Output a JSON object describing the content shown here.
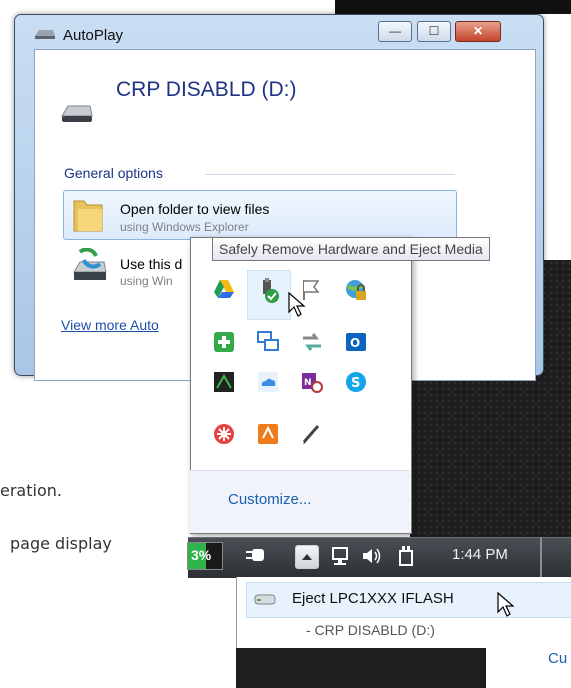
{
  "background": {
    "line1": "eration.",
    "line2": "page display"
  },
  "autoplay": {
    "title": "AutoPlay",
    "drive_label": "CRP DISABLD (D:)",
    "section_label": "General options",
    "option1_main": "Open folder to view files",
    "option1_sub": "using Windows Explorer",
    "option2_main": "Use this d",
    "option2_sub": "using Win",
    "link": "View more Auto"
  },
  "tray": {
    "tooltip": "Safely Remove Hardware and Eject Media",
    "customize_label": "Customize..."
  },
  "taskbar": {
    "battery_text": "3%",
    "clock": "1:44 PM"
  },
  "eject_menu": {
    "item_main": "Eject LPC1XXX IFLASH",
    "item_sub": "-  CRP DISABLD (D:)",
    "partial_link": "Cu"
  },
  "colors": {
    "accent_blue": "#1e3287",
    "link_blue": "#1b5fad",
    "taskbar": "#2c3035"
  }
}
